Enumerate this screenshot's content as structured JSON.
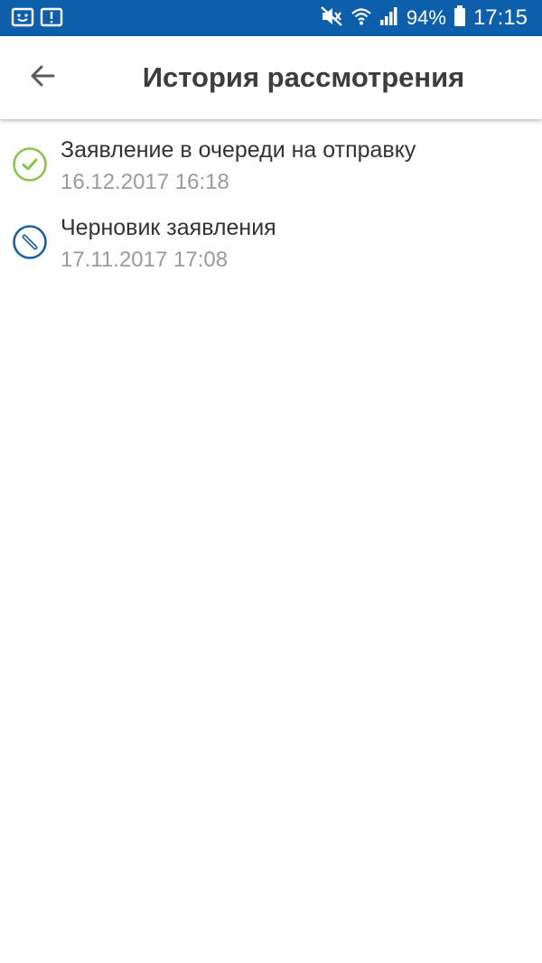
{
  "status_bar": {
    "battery_text": "94%",
    "clock": "17:15",
    "icons": [
      "smiley-notification-icon",
      "alert-notification-icon",
      "mute-icon",
      "wifi-icon",
      "signal-icon",
      "battery-icon"
    ],
    "background_color": "#0d5fac"
  },
  "header": {
    "title": "История рассмотрения",
    "back_icon": "arrow-left-icon"
  },
  "history": {
    "items": [
      {
        "title": "Заявление в очереди на отправку",
        "date": "16.12.2017 16:18",
        "icon": "check-circle-icon",
        "icon_color": "#8bc34a"
      },
      {
        "title": "Черновик заявления",
        "date": "17.11.2017 17:08",
        "icon": "pencil-circle-icon",
        "icon_color": "#1e5f9e"
      }
    ]
  }
}
